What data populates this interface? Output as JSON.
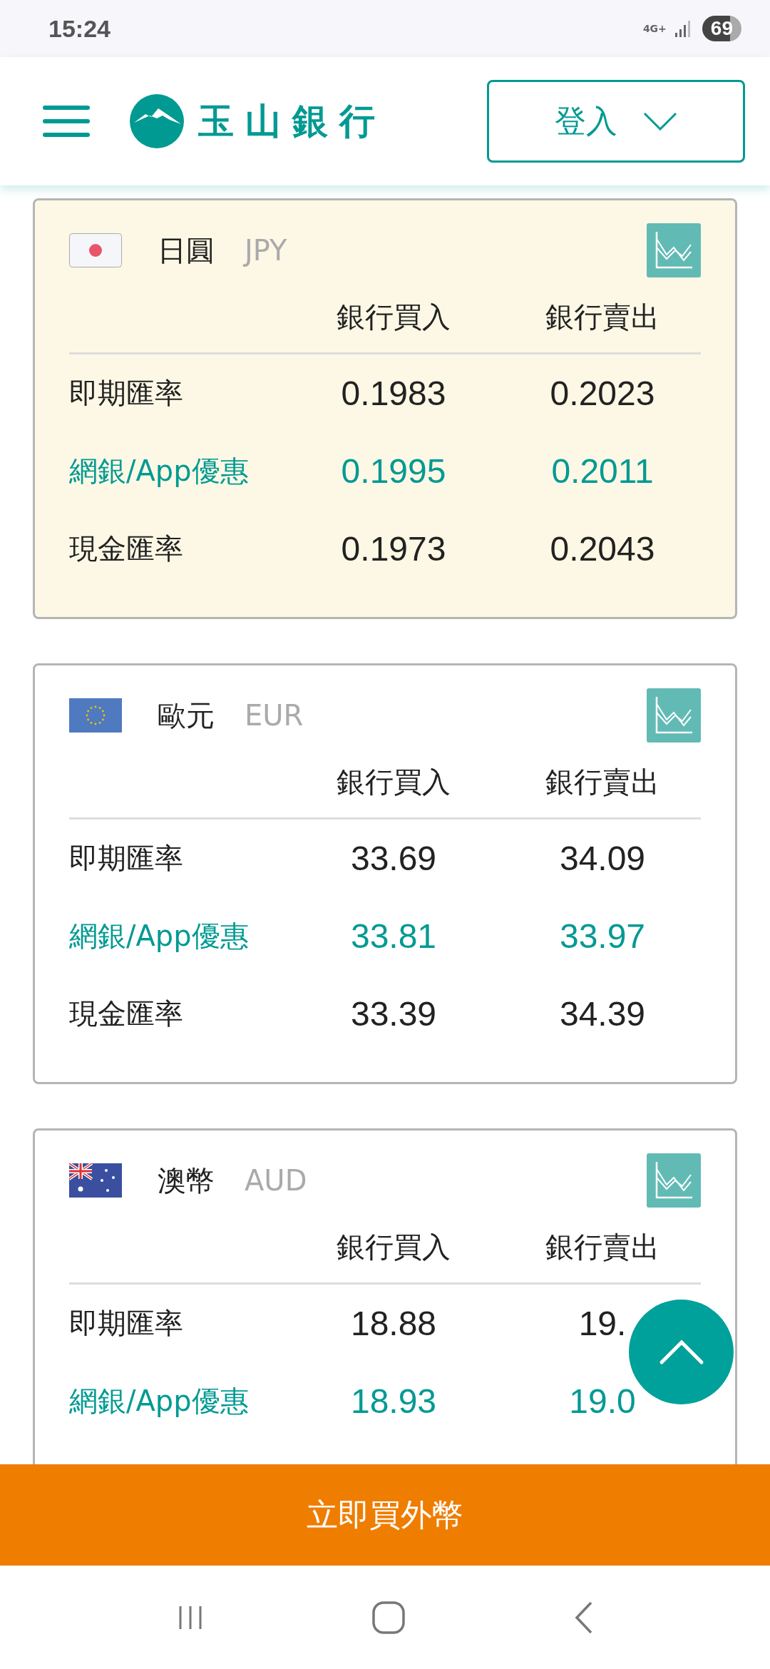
{
  "status_bar": {
    "time": "15:24",
    "network": "4G+",
    "battery": "69"
  },
  "header": {
    "bank_name": "玉山銀行",
    "login_button": "登入"
  },
  "currencies": [
    {
      "kind": "jp",
      "name": "日圓",
      "code": "JPY",
      "selected": true,
      "columns": [
        "銀行買入",
        "銀行賣出"
      ],
      "rows": [
        {
          "label": "即期匯率",
          "buy": "0.1983",
          "sell": "0.2023",
          "highlighted": false
        },
        {
          "label": "網銀/App優惠",
          "buy": "0.1995",
          "sell": "0.2011",
          "highlighted": true
        },
        {
          "label": "現金匯率",
          "buy": "0.1973",
          "sell": "0.2043",
          "highlighted": false
        }
      ]
    },
    {
      "kind": "eu",
      "name": "歐元",
      "code": "EUR",
      "selected": false,
      "columns": [
        "銀行買入",
        "銀行賣出"
      ],
      "rows": [
        {
          "label": "即期匯率",
          "buy": "33.69",
          "sell": "34.09",
          "highlighted": false
        },
        {
          "label": "網銀/App優惠",
          "buy": "33.81",
          "sell": "33.97",
          "highlighted": true
        },
        {
          "label": "現金匯率",
          "buy": "33.39",
          "sell": "34.39",
          "highlighted": false
        }
      ]
    },
    {
      "kind": "au",
      "name": "澳幣",
      "code": "AUD",
      "selected": false,
      "columns": [
        "銀行買入",
        "銀行賣出"
      ],
      "rows": [
        {
          "label": "即期匯率",
          "buy": "18.88",
          "sell": "19.",
          "highlighted": false
        },
        {
          "label": "網銀/App優惠",
          "buy": "18.93",
          "sell": "19.0",
          "highlighted": true
        }
      ]
    }
  ],
  "buy_button": "立即買外幣"
}
